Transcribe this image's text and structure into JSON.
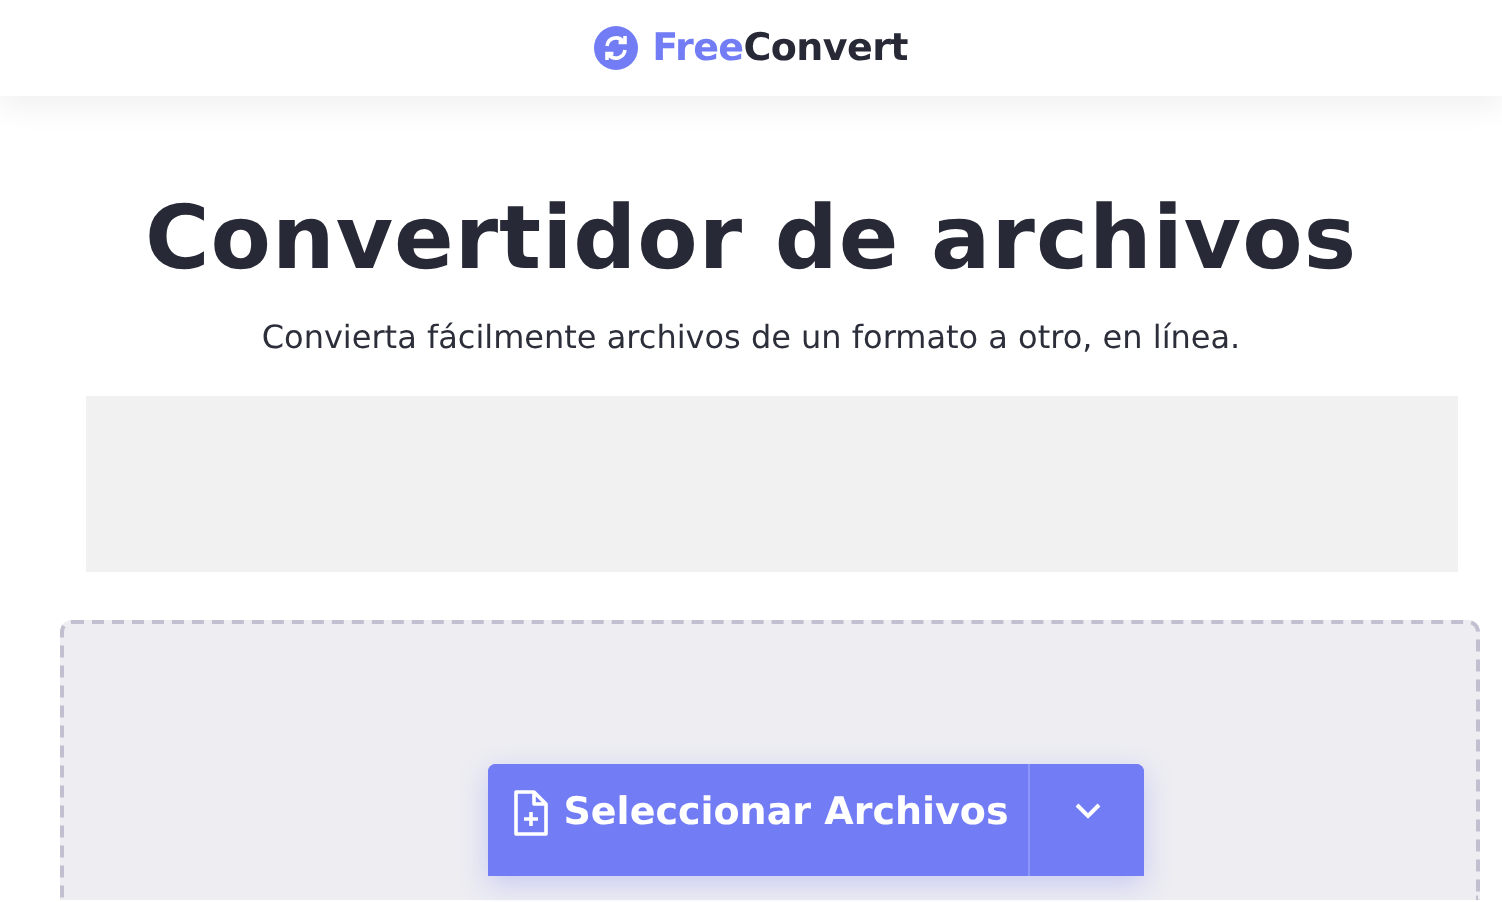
{
  "header": {
    "logo_first": "Free",
    "logo_second": "Convert"
  },
  "title": "Convertidor de archivos",
  "subtitle": "Convierta fácilmente archivos de un formato a otro, en línea.",
  "upload": {
    "button": "Seleccionar Archivos"
  }
}
